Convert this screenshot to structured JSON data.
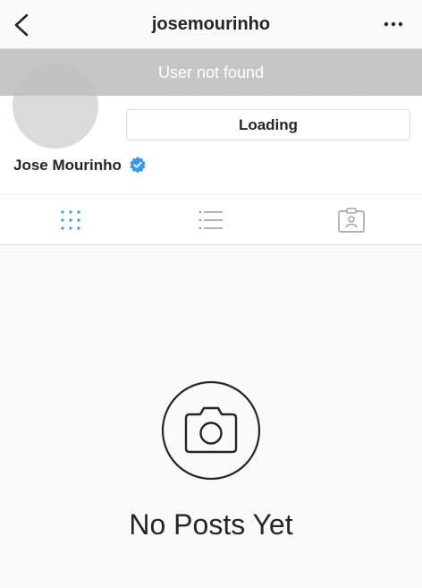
{
  "nav": {
    "title": "josemourinho",
    "back_icon": "chevron-left-icon",
    "more_icon": "more-horizontal-icon"
  },
  "banner": {
    "text": "User not found"
  },
  "profile": {
    "loading_label": "Loading",
    "name": "Jose Mourinho",
    "verified_icon": "verified-badge-icon",
    "verified_color": "#3897f0"
  },
  "tabs": [
    {
      "icon": "grid-icon",
      "active": true,
      "color": "#3897f0"
    },
    {
      "icon": "list-icon",
      "active": false
    },
    {
      "icon": "tagged-icon",
      "active": false
    }
  ],
  "empty_state": {
    "icon": "camera-icon",
    "text": "No Posts Yet"
  }
}
